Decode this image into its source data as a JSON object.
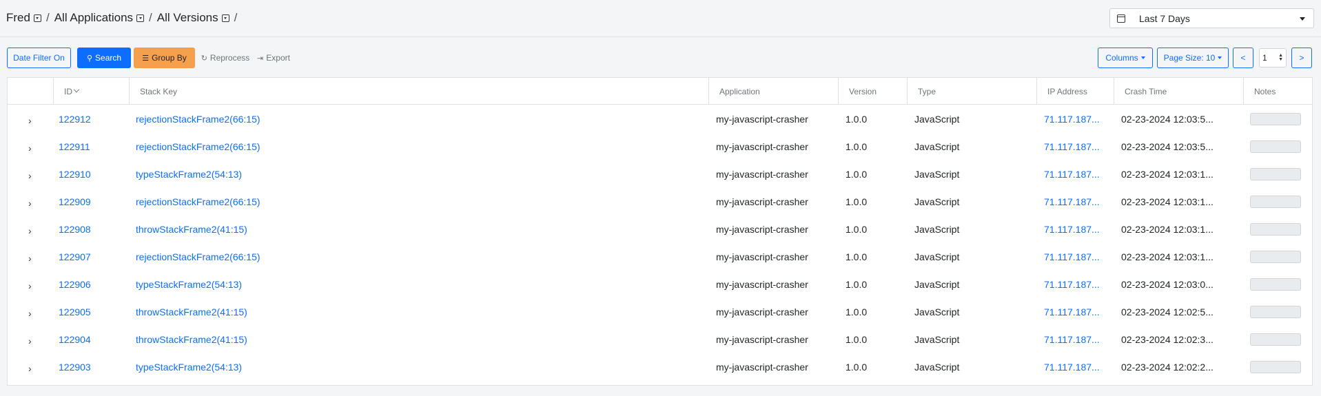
{
  "breadcrumb": {
    "items": [
      "Fred",
      "All Applications",
      "All Versions"
    ],
    "separator": "/"
  },
  "date_range": {
    "selected": "Last 7 Days"
  },
  "toolbar": {
    "date_filter_label": "Date Filter On",
    "search_label": "Search",
    "group_by_label": "Group By",
    "reprocess_label": "Reprocess",
    "export_label": "Export",
    "columns_label": "Columns",
    "page_size_label": "Page Size: 10",
    "prev_label": "<",
    "next_label": ">",
    "page_number": "1"
  },
  "table": {
    "columns": [
      "ID",
      "Stack Key",
      "Application",
      "Version",
      "Type",
      "IP Address",
      "Crash Time",
      "Notes"
    ],
    "rows": [
      {
        "id": "122912",
        "stack_key": "rejectionStackFrame2(66:15)",
        "application": "my-javascript-crasher",
        "version": "1.0.0",
        "type": "JavaScript",
        "ip": "71.117.187...",
        "crash_time": "02-23-2024 12:03:5..."
      },
      {
        "id": "122911",
        "stack_key": "rejectionStackFrame2(66:15)",
        "application": "my-javascript-crasher",
        "version": "1.0.0",
        "type": "JavaScript",
        "ip": "71.117.187...",
        "crash_time": "02-23-2024 12:03:5..."
      },
      {
        "id": "122910",
        "stack_key": "typeStackFrame2(54:13)",
        "application": "my-javascript-crasher",
        "version": "1.0.0",
        "type": "JavaScript",
        "ip": "71.117.187...",
        "crash_time": "02-23-2024 12:03:1..."
      },
      {
        "id": "122909",
        "stack_key": "rejectionStackFrame2(66:15)",
        "application": "my-javascript-crasher",
        "version": "1.0.0",
        "type": "JavaScript",
        "ip": "71.117.187...",
        "crash_time": "02-23-2024 12:03:1..."
      },
      {
        "id": "122908",
        "stack_key": "throwStackFrame2(41:15)",
        "application": "my-javascript-crasher",
        "version": "1.0.0",
        "type": "JavaScript",
        "ip": "71.117.187...",
        "crash_time": "02-23-2024 12:03:1..."
      },
      {
        "id": "122907",
        "stack_key": "rejectionStackFrame2(66:15)",
        "application": "my-javascript-crasher",
        "version": "1.0.0",
        "type": "JavaScript",
        "ip": "71.117.187...",
        "crash_time": "02-23-2024 12:03:1..."
      },
      {
        "id": "122906",
        "stack_key": "typeStackFrame2(54:13)",
        "application": "my-javascript-crasher",
        "version": "1.0.0",
        "type": "JavaScript",
        "ip": "71.117.187...",
        "crash_time": "02-23-2024 12:03:0..."
      },
      {
        "id": "122905",
        "stack_key": "throwStackFrame2(41:15)",
        "application": "my-javascript-crasher",
        "version": "1.0.0",
        "type": "JavaScript",
        "ip": "71.117.187...",
        "crash_time": "02-23-2024 12:02:5..."
      },
      {
        "id": "122904",
        "stack_key": "throwStackFrame2(41:15)",
        "application": "my-javascript-crasher",
        "version": "1.0.0",
        "type": "JavaScript",
        "ip": "71.117.187...",
        "crash_time": "02-23-2024 12:02:3..."
      },
      {
        "id": "122903",
        "stack_key": "typeStackFrame2(54:13)",
        "application": "my-javascript-crasher",
        "version": "1.0.0",
        "type": "JavaScript",
        "ip": "71.117.187...",
        "crash_time": "02-23-2024 12:02:2..."
      }
    ]
  },
  "colors": {
    "accent": "#0d6efd",
    "group_by": "#f5a04c",
    "background": "#f3f5f7"
  }
}
